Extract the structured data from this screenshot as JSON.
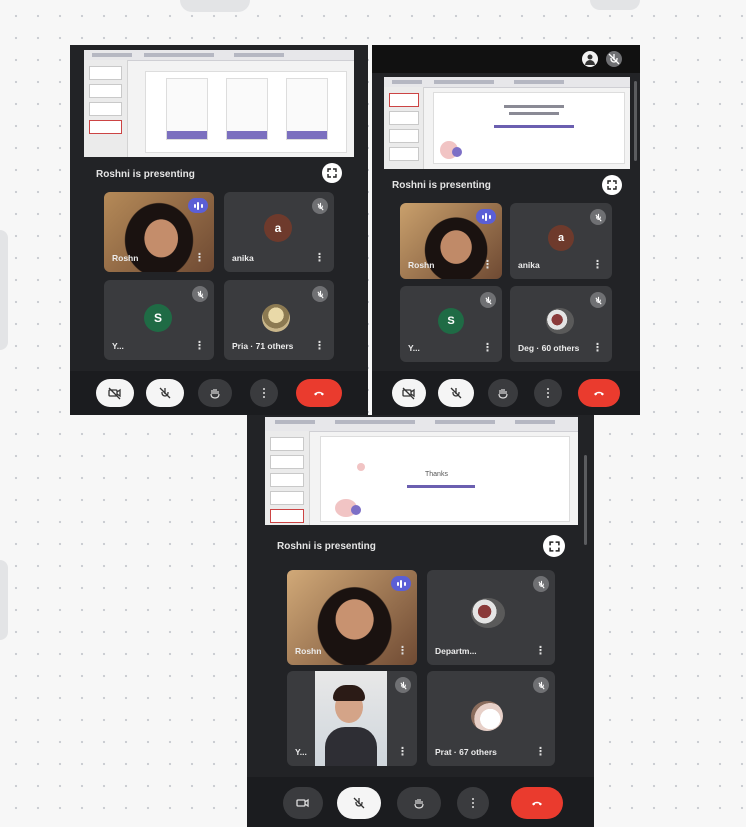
{
  "shot1": {
    "presenting_label": "Roshni is presenting",
    "tiles": [
      {
        "name": "Roshn",
        "type": "photo",
        "speaking": true
      },
      {
        "name": "anika",
        "type": "letter",
        "letter": "a",
        "color": "#6e3a2c"
      },
      {
        "name": "Y...",
        "type": "letter",
        "letter": "S",
        "color": "#1f6b45"
      },
      {
        "name": "Pria · 71 others",
        "type": "image"
      }
    ]
  },
  "shot2": {
    "presenting_label": "Roshni is presenting",
    "tiles": [
      {
        "name": "Roshn",
        "type": "photo",
        "speaking": true
      },
      {
        "name": "anika",
        "type": "letter",
        "letter": "a",
        "color": "#6e3a2c"
      },
      {
        "name": "Y...",
        "type": "letter",
        "letter": "S",
        "color": "#1f6b45"
      },
      {
        "name": "Deg · 60 others",
        "type": "image"
      }
    ]
  },
  "shot3": {
    "presenting_label": "Roshni is presenting",
    "slide_title": "Thanks",
    "tiles": [
      {
        "name": "Roshn",
        "type": "photo",
        "speaking": true
      },
      {
        "name": "Departm...",
        "type": "image"
      },
      {
        "name": "Y...",
        "type": "video"
      },
      {
        "name": "Prat · 67 others",
        "type": "image"
      }
    ]
  },
  "icons": {
    "camera_off": "camera-off-icon",
    "mic_off": "mic-off-icon",
    "raise_hand": "hand-icon",
    "more": "more-vert-icon",
    "end_call": "phone-hangup-icon",
    "fullscreen": "fullscreen-icon",
    "speaking": "audio-levels-icon"
  },
  "colors": {
    "background": "#f7f7f7",
    "meet_dark": "#222326",
    "tile": "#3a3b3e",
    "end_call_red": "#ea3b2e",
    "speaking_badge": "#5b5fd6"
  }
}
